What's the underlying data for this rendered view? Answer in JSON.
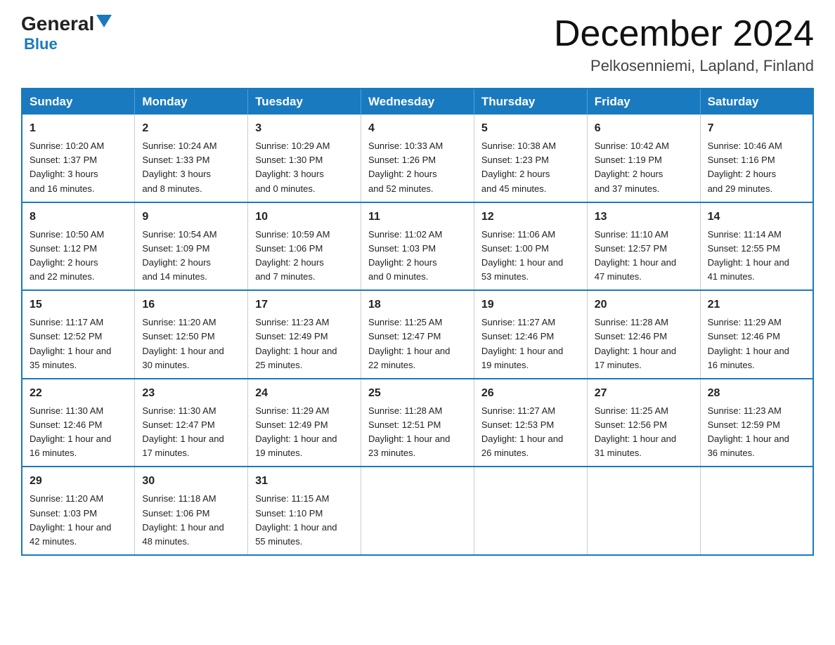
{
  "header": {
    "logo_main": "General",
    "logo_sub": "Blue",
    "month_title": "December 2024",
    "location": "Pelkosenniemi, Lapland, Finland"
  },
  "days_of_week": [
    "Sunday",
    "Monday",
    "Tuesday",
    "Wednesday",
    "Thursday",
    "Friday",
    "Saturday"
  ],
  "weeks": [
    [
      {
        "day": "1",
        "info": "Sunrise: 10:20 AM\nSunset: 1:37 PM\nDaylight: 3 hours\nand 16 minutes."
      },
      {
        "day": "2",
        "info": "Sunrise: 10:24 AM\nSunset: 1:33 PM\nDaylight: 3 hours\nand 8 minutes."
      },
      {
        "day": "3",
        "info": "Sunrise: 10:29 AM\nSunset: 1:30 PM\nDaylight: 3 hours\nand 0 minutes."
      },
      {
        "day": "4",
        "info": "Sunrise: 10:33 AM\nSunset: 1:26 PM\nDaylight: 2 hours\nand 52 minutes."
      },
      {
        "day": "5",
        "info": "Sunrise: 10:38 AM\nSunset: 1:23 PM\nDaylight: 2 hours\nand 45 minutes."
      },
      {
        "day": "6",
        "info": "Sunrise: 10:42 AM\nSunset: 1:19 PM\nDaylight: 2 hours\nand 37 minutes."
      },
      {
        "day": "7",
        "info": "Sunrise: 10:46 AM\nSunset: 1:16 PM\nDaylight: 2 hours\nand 29 minutes."
      }
    ],
    [
      {
        "day": "8",
        "info": "Sunrise: 10:50 AM\nSunset: 1:12 PM\nDaylight: 2 hours\nand 22 minutes."
      },
      {
        "day": "9",
        "info": "Sunrise: 10:54 AM\nSunset: 1:09 PM\nDaylight: 2 hours\nand 14 minutes."
      },
      {
        "day": "10",
        "info": "Sunrise: 10:59 AM\nSunset: 1:06 PM\nDaylight: 2 hours\nand 7 minutes."
      },
      {
        "day": "11",
        "info": "Sunrise: 11:02 AM\nSunset: 1:03 PM\nDaylight: 2 hours\nand 0 minutes."
      },
      {
        "day": "12",
        "info": "Sunrise: 11:06 AM\nSunset: 1:00 PM\nDaylight: 1 hour and\n53 minutes."
      },
      {
        "day": "13",
        "info": "Sunrise: 11:10 AM\nSunset: 12:57 PM\nDaylight: 1 hour and\n47 minutes."
      },
      {
        "day": "14",
        "info": "Sunrise: 11:14 AM\nSunset: 12:55 PM\nDaylight: 1 hour and\n41 minutes."
      }
    ],
    [
      {
        "day": "15",
        "info": "Sunrise: 11:17 AM\nSunset: 12:52 PM\nDaylight: 1 hour and\n35 minutes."
      },
      {
        "day": "16",
        "info": "Sunrise: 11:20 AM\nSunset: 12:50 PM\nDaylight: 1 hour and\n30 minutes."
      },
      {
        "day": "17",
        "info": "Sunrise: 11:23 AM\nSunset: 12:49 PM\nDaylight: 1 hour and\n25 minutes."
      },
      {
        "day": "18",
        "info": "Sunrise: 11:25 AM\nSunset: 12:47 PM\nDaylight: 1 hour and\n22 minutes."
      },
      {
        "day": "19",
        "info": "Sunrise: 11:27 AM\nSunset: 12:46 PM\nDaylight: 1 hour and\n19 minutes."
      },
      {
        "day": "20",
        "info": "Sunrise: 11:28 AM\nSunset: 12:46 PM\nDaylight: 1 hour and\n17 minutes."
      },
      {
        "day": "21",
        "info": "Sunrise: 11:29 AM\nSunset: 12:46 PM\nDaylight: 1 hour and\n16 minutes."
      }
    ],
    [
      {
        "day": "22",
        "info": "Sunrise: 11:30 AM\nSunset: 12:46 PM\nDaylight: 1 hour and\n16 minutes."
      },
      {
        "day": "23",
        "info": "Sunrise: 11:30 AM\nSunset: 12:47 PM\nDaylight: 1 hour and\n17 minutes."
      },
      {
        "day": "24",
        "info": "Sunrise: 11:29 AM\nSunset: 12:49 PM\nDaylight: 1 hour and\n19 minutes."
      },
      {
        "day": "25",
        "info": "Sunrise: 11:28 AM\nSunset: 12:51 PM\nDaylight: 1 hour and\n23 minutes."
      },
      {
        "day": "26",
        "info": "Sunrise: 11:27 AM\nSunset: 12:53 PM\nDaylight: 1 hour and\n26 minutes."
      },
      {
        "day": "27",
        "info": "Sunrise: 11:25 AM\nSunset: 12:56 PM\nDaylight: 1 hour and\n31 minutes."
      },
      {
        "day": "28",
        "info": "Sunrise: 11:23 AM\nSunset: 12:59 PM\nDaylight: 1 hour and\n36 minutes."
      }
    ],
    [
      {
        "day": "29",
        "info": "Sunrise: 11:20 AM\nSunset: 1:03 PM\nDaylight: 1 hour and\n42 minutes."
      },
      {
        "day": "30",
        "info": "Sunrise: 11:18 AM\nSunset: 1:06 PM\nDaylight: 1 hour and\n48 minutes."
      },
      {
        "day": "31",
        "info": "Sunrise: 11:15 AM\nSunset: 1:10 PM\nDaylight: 1 hour and\n55 minutes."
      },
      {
        "day": "",
        "info": ""
      },
      {
        "day": "",
        "info": ""
      },
      {
        "day": "",
        "info": ""
      },
      {
        "day": "",
        "info": ""
      }
    ]
  ]
}
